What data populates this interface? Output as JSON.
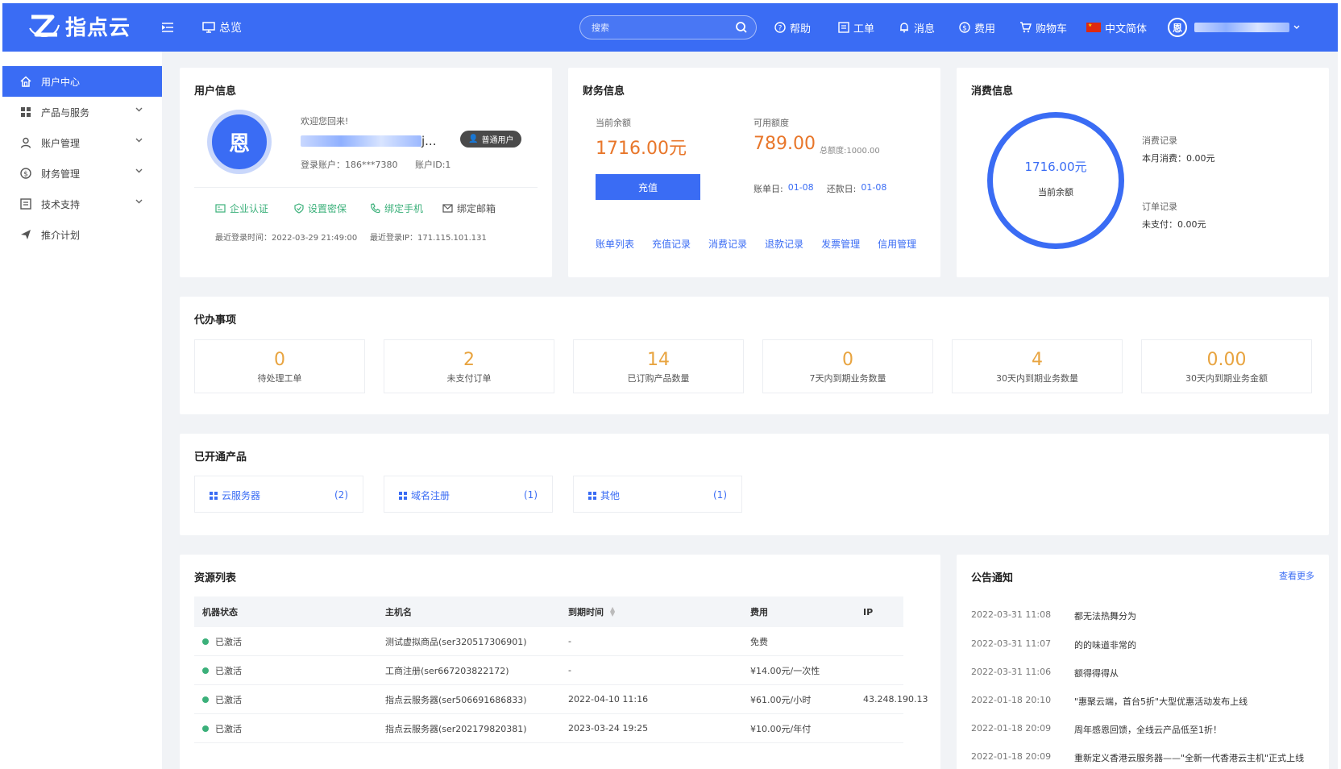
{
  "header": {
    "brand": "指点云",
    "overview": "总览",
    "search_placeholder": "搜索",
    "help": "帮助",
    "tickets": "工单",
    "messages": "消息",
    "fees": "费用",
    "cart": "购物车",
    "language": "中文简体",
    "user_initial": "恩"
  },
  "sidebar": {
    "items": [
      {
        "label": "用户中心",
        "icon": "home-icon"
      },
      {
        "label": "产品与服务",
        "icon": "grid-icon"
      },
      {
        "label": "账户管理",
        "icon": "user-icon"
      },
      {
        "label": "财务管理",
        "icon": "dollar-icon"
      },
      {
        "label": "技术支持",
        "icon": "document-icon"
      },
      {
        "label": "推介计划",
        "icon": "send-icon"
      }
    ]
  },
  "user_info": {
    "title": "用户信息",
    "avatar": "恩",
    "welcome": "欢迎您回来!",
    "name_suffix": "j...",
    "badge": "普通用户",
    "account": "登录账户：186***7380",
    "account_id": "账户ID:1",
    "actions": [
      "企业认证",
      "设置密保",
      "绑定手机",
      "绑定邮箱"
    ],
    "last_login_time": "最近登录时间：2022-03-29 21:49:00",
    "last_login_ip": "最近登录IP：171.115.101.131"
  },
  "finance": {
    "title": "财务信息",
    "balance_label": "当前余额",
    "balance": "1716.00元",
    "credit_label": "可用额度",
    "credit": "789.00",
    "credit_total": "总额度:1000.00",
    "recharge": "充值",
    "bill_day_label": "账单日:",
    "bill_day": "01-08",
    "repay_day_label": "还款日:",
    "repay_day": "01-08",
    "links": [
      "账单列表",
      "充值记录",
      "消费记录",
      "退款记录",
      "发票管理",
      "信用管理"
    ]
  },
  "consumption": {
    "title": "消费信息",
    "ring_value": "1716.00元",
    "ring_label": "当前余额",
    "consume_record": "消费记录",
    "month_consume": "本月消费：0.00元",
    "order_record": "订单记录",
    "unpaid": "未支付：0.00元"
  },
  "todo": {
    "title": "代办事项",
    "items": [
      {
        "value": "0",
        "label": "待处理工单"
      },
      {
        "value": "2",
        "label": "未支付订单"
      },
      {
        "value": "14",
        "label": "已订购产品数量"
      },
      {
        "value": "0",
        "label": "7天内到期业务数量"
      },
      {
        "value": "4",
        "label": "30天内到期业务数量"
      },
      {
        "value": "0.00",
        "label": "30天内到期业务金额"
      }
    ]
  },
  "products": {
    "title": "已开通产品",
    "items": [
      {
        "name": "云服务器",
        "count": "(2)"
      },
      {
        "name": "域名注册",
        "count": "(1)"
      },
      {
        "name": "其他",
        "count": "(1)"
      }
    ]
  },
  "resources": {
    "title": "资源列表",
    "columns": [
      "机器状态",
      "主机名",
      "到期时间",
      "费用",
      "IP"
    ],
    "rows": [
      {
        "status": "已激活",
        "host": "测试虚拟商品(ser320517306901)",
        "expire": "-",
        "fee": "免费",
        "ip": ""
      },
      {
        "status": "已激活",
        "host": "工商注册(ser667203822172)",
        "expire": "-",
        "fee": "¥14.00元/一次性",
        "ip": ""
      },
      {
        "status": "已激活",
        "host": "指点云服务器(ser506691686833)",
        "expire": "2022-04-10 11:16",
        "fee": "¥61.00元/小时",
        "ip": "43.248.190.13"
      },
      {
        "status": "已激活",
        "host": "指点云服务器(ser202179820381)",
        "expire": "2023-03-24 19:25",
        "fee": "¥10.00元/年付",
        "ip": ""
      }
    ]
  },
  "notices": {
    "title": "公告通知",
    "more": "查看更多",
    "items": [
      {
        "date": "2022-03-31 11:08",
        "text": "都无法热舞分为"
      },
      {
        "date": "2022-03-31 11:07",
        "text": "的的味道非常的"
      },
      {
        "date": "2022-03-31 11:06",
        "text": "额得得得从"
      },
      {
        "date": "2022-01-18 20:10",
        "text": "\"惠聚云端，首台5折\"大型优惠活动发布上线"
      },
      {
        "date": "2022-01-18 20:09",
        "text": "周年感恩回馈，全线云产品低至1折！"
      },
      {
        "date": "2022-01-18 20:09",
        "text": "重新定义香港云服务器——\"全新一代香港云主机\"正式上线"
      }
    ]
  },
  "colors": {
    "primary": "#3a6cf4",
    "orange": "#e8762a",
    "gold": "#e8a440",
    "green": "#3bb07a"
  }
}
